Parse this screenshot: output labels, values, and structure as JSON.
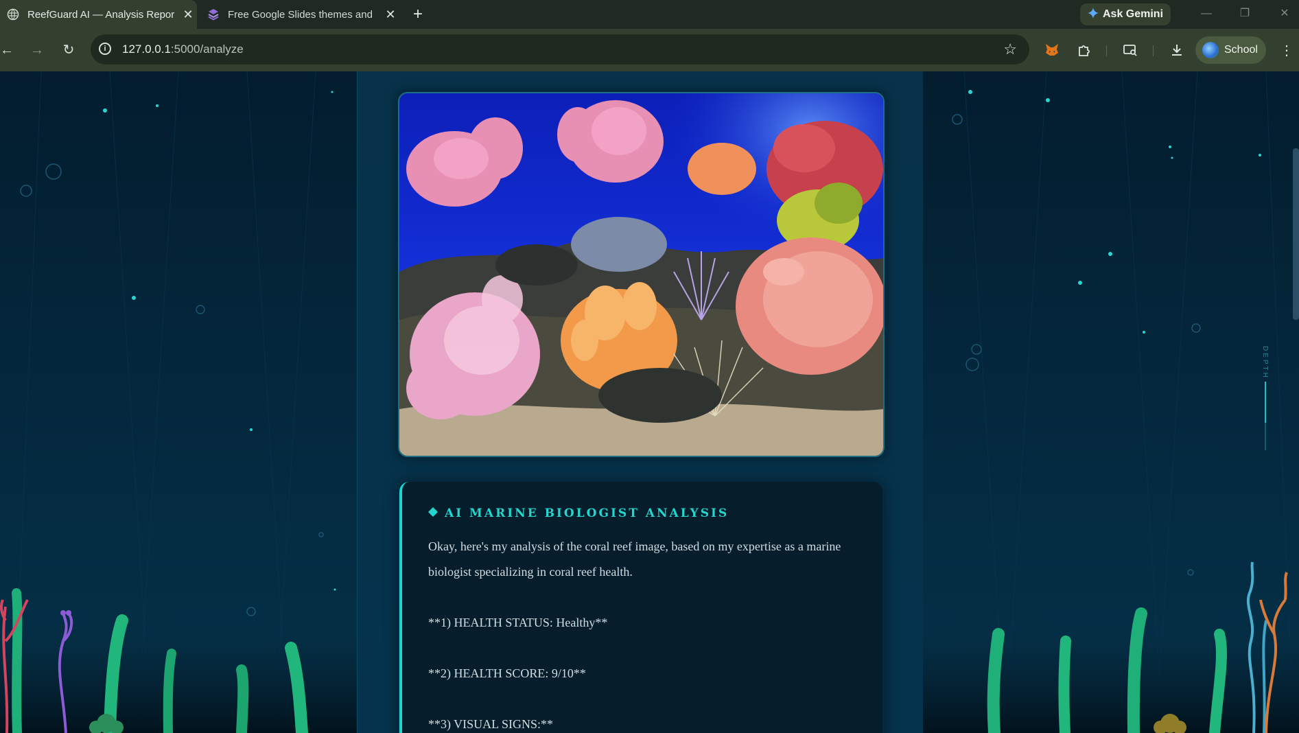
{
  "browser": {
    "tabs": [
      {
        "title": "ReefGuard AI — Analysis Repor",
        "active": true
      },
      {
        "title": "Free Google Slides themes and",
        "active": false
      }
    ],
    "new_tab_symbol": "+",
    "gemini_label": "Ask Gemini",
    "url_host": "127.0.0.1",
    "url_path": ":5000/analyze",
    "profile_label": "School"
  },
  "page": {
    "image_alt": "Coral reef image",
    "analysis": {
      "title": "AI MARINE BIOLOGIST ANALYSIS",
      "paragraphs": [
        "Okay, here's my analysis of the coral reef image, based on my expertise as a marine biologist specializing in coral reef health.",
        "**1) HEALTH STATUS: Healthy**",
        "**2) HEALTH SCORE: 9/10**",
        "**3) VISUAL SIGNS:**"
      ]
    },
    "depth_label": "DEPTH",
    "depth_level": 0.6
  },
  "colors": {
    "accent": "#23d7cf",
    "page_bg": "#05263a",
    "card_bg": "#061e2c"
  }
}
